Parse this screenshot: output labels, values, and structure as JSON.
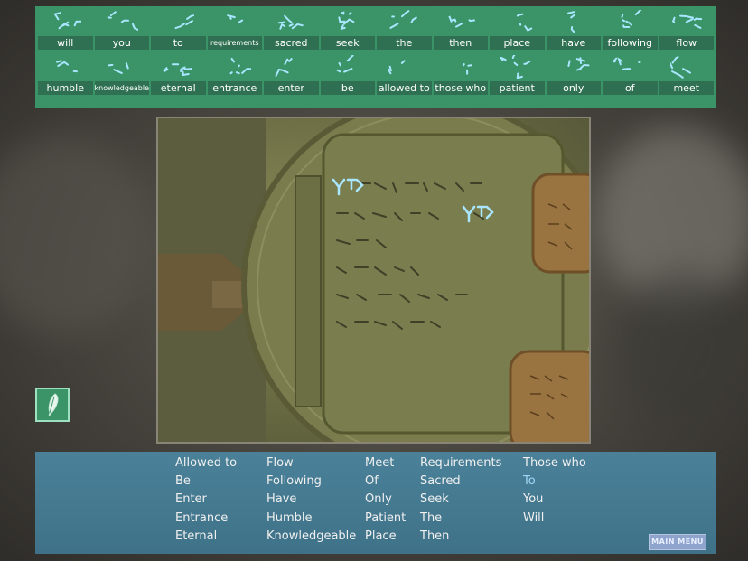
{
  "glossary": {
    "row1": [
      "will",
      "you",
      "to",
      "requirements",
      "sacred",
      "seek",
      "the",
      "then",
      "place",
      "have",
      "following",
      "flow"
    ],
    "row2": [
      "humble",
      "knowledgeable",
      "eternal",
      "entrance",
      "enter",
      "be",
      "allowed to",
      "those who",
      "patient",
      "only",
      "of",
      "meet"
    ]
  },
  "wordbank": {
    "col1": [
      "Allowed to",
      "Be",
      "Enter",
      "Entrance",
      "Eternal"
    ],
    "col2": [
      "Flow",
      "Following",
      "Have",
      "Humble",
      "Knowledgeable"
    ],
    "col3": [
      "Meet",
      "Of",
      "Only",
      "Patient",
      "Place"
    ],
    "col4": [
      "Requirements",
      "Sacred",
      "Seek",
      "The",
      "Then"
    ],
    "col5": [
      "Those who",
      "To",
      "You",
      "Will"
    ],
    "highlighted": "To",
    "main_menu_label": "MAIN MENU"
  },
  "icons": {
    "left_button": "quill-icon"
  },
  "colors": {
    "glossary_bg": "#3b9468",
    "glossary_label_bg": "#2f7052",
    "wordbank_bg": "#4a8199",
    "highlight_text": "#9fd7f5",
    "glyph_color": "#a9e6ff"
  }
}
